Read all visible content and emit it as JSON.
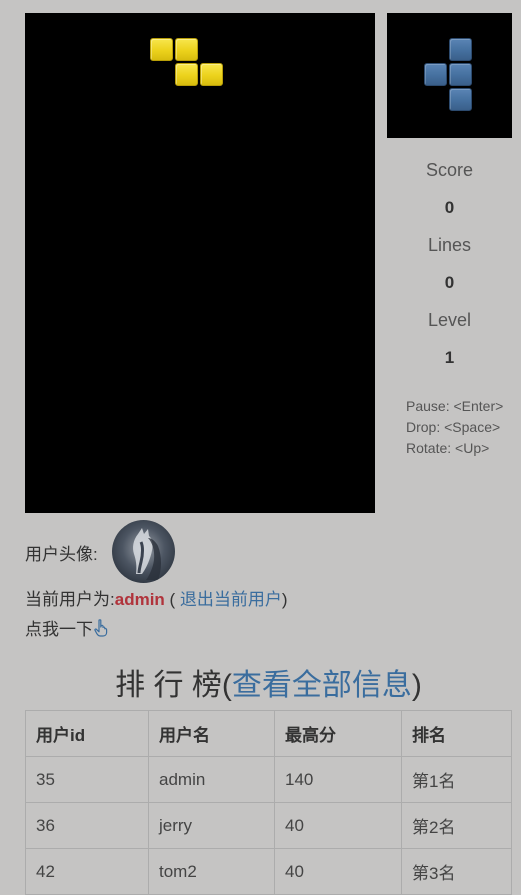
{
  "game": {
    "current_piece": {
      "shape": "Z",
      "color": "#ecd21c",
      "cells": [
        [
          0,
          0
        ],
        [
          1,
          0
        ],
        [
          1,
          1
        ],
        [
          2,
          1
        ]
      ]
    },
    "next_piece": {
      "shape": "T",
      "color": "#45709f",
      "cells": [
        [
          1,
          0
        ],
        [
          0,
          1
        ],
        [
          1,
          1
        ],
        [
          1,
          2
        ]
      ]
    }
  },
  "stats": {
    "score_label": "Score",
    "score_value": "0",
    "lines_label": "Lines",
    "lines_value": "0",
    "level_label": "Level",
    "level_value": "1"
  },
  "controls": {
    "pause": "Pause: <Enter>",
    "drop": "Drop: <Space>",
    "rotate": "Rotate: <Up>"
  },
  "user": {
    "avatar_label": "用户头像:",
    "current_prefix": "当前用户为:",
    "username": "admin",
    "paren_open": " ( ",
    "logout_link": "退出当前用户",
    "paren_close": ")",
    "click_me": "点我一下"
  },
  "leaderboard": {
    "title": "排 行 榜",
    "title_open": "(",
    "view_all_link": "查看全部信息",
    "title_close": ")",
    "headers": [
      "用户id",
      "用户名",
      "最高分",
      "排名"
    ],
    "rows": [
      [
        "35",
        "admin",
        "140",
        "第1名"
      ],
      [
        "36",
        "jerry",
        "40",
        "第2名"
      ],
      [
        "42",
        "tom2",
        "40",
        "第3名"
      ]
    ]
  }
}
